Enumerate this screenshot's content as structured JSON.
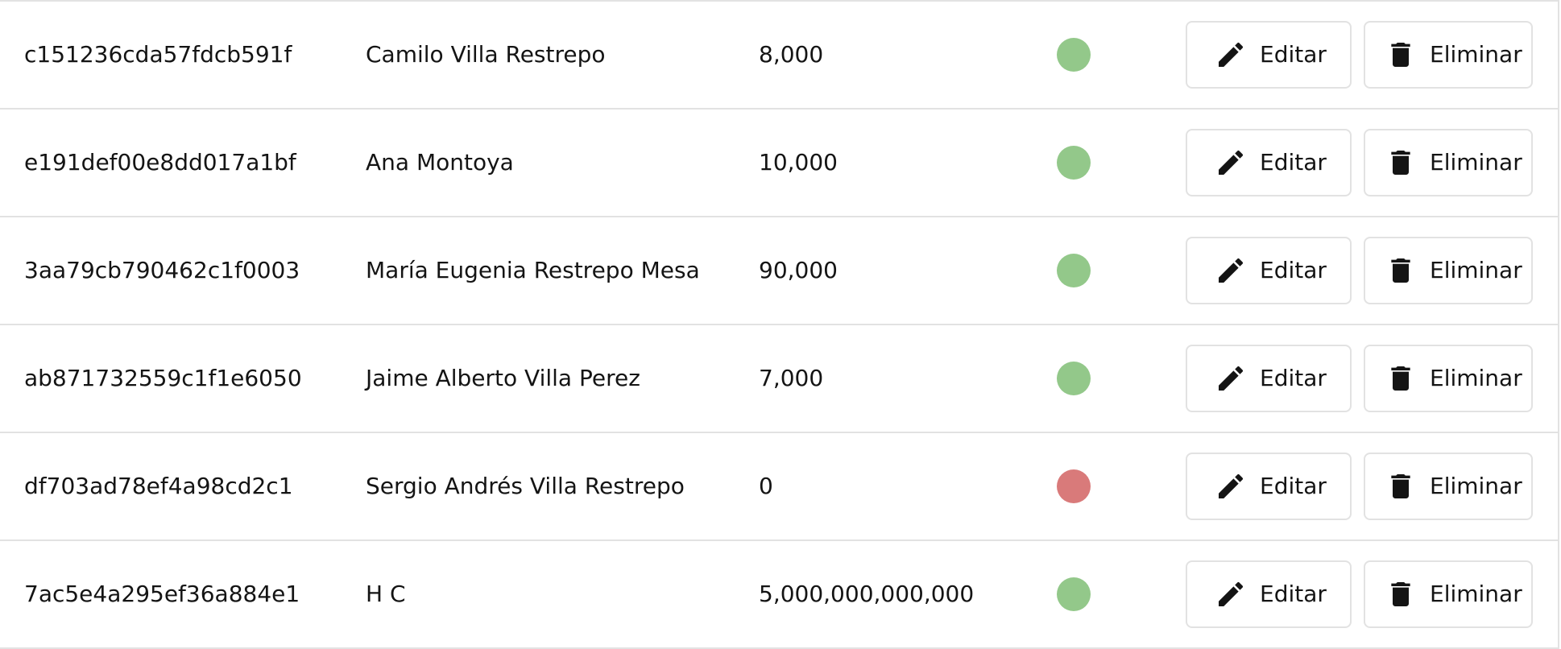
{
  "colors": {
    "active": "#93c88a",
    "inactive": "#d97a7a",
    "border": "#e2e2e2",
    "text": "#141414"
  },
  "icons": {
    "edit": "pencil-icon",
    "delete": "trash-icon"
  },
  "rows": [
    {
      "id": "c151236cda57fdcb591f",
      "name": "Camilo Villa Restrepo",
      "amount": "8,000",
      "status": "active",
      "edit_label": "Editar",
      "delete_label": "Eliminar"
    },
    {
      "id": "e191def00e8dd017a1bf",
      "name": "Ana Montoya",
      "amount": "10,000",
      "status": "active",
      "edit_label": "Editar",
      "delete_label": "Eliminar"
    },
    {
      "id": "3aa79cb790462c1f0003",
      "name": "María Eugenia Restrepo Mesa",
      "amount": "90,000",
      "status": "active",
      "edit_label": "Editar",
      "delete_label": "Eliminar"
    },
    {
      "id": "ab871732559c1f1e6050",
      "name": "Jaime Alberto Villa Perez",
      "amount": "7,000",
      "status": "active",
      "edit_label": "Editar",
      "delete_label": "Eliminar"
    },
    {
      "id": "df703ad78ef4a98cd2c1",
      "name": "Sergio Andrés Villa Restrepo",
      "amount": "0",
      "status": "inactive",
      "edit_label": "Editar",
      "delete_label": "Eliminar"
    },
    {
      "id": "7ac5e4a295ef36a884e1",
      "name": "H C",
      "amount": "5,000,000,000,000",
      "status": "active",
      "edit_label": "Editar",
      "delete_label": "Eliminar"
    }
  ]
}
